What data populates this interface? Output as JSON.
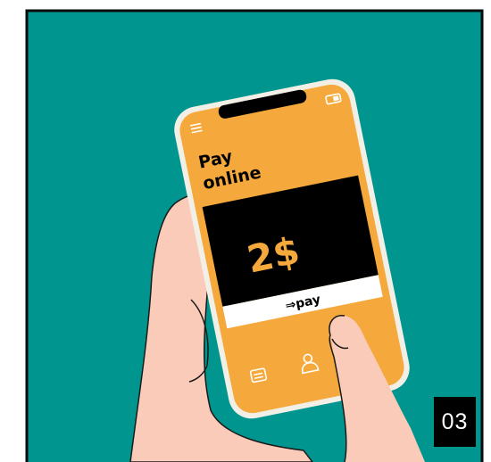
{
  "colors": {
    "background": "#00968f",
    "frame": "#0a0a0a",
    "phone_body": "#f5a93c",
    "phone_bezel": "#f2efe6",
    "payment_panel": "#000000",
    "amount_text": "#f5a93c",
    "pay_button": "#ffffff",
    "skin": "#f9cbb8",
    "skin_outline": "#1a1a1a",
    "icon_stroke": "#ffffff",
    "badge_background": "#000000",
    "badge_text": "#ffffff"
  },
  "phone": {
    "title_line1": "Pay",
    "title_line2": "online",
    "amount": "2$",
    "pay_button_label": "⇒pay",
    "icons": [
      "menu-icon",
      "toggle-icon",
      "receipt-icon",
      "user-icon",
      "gear-icon"
    ]
  },
  "step_label": "03"
}
